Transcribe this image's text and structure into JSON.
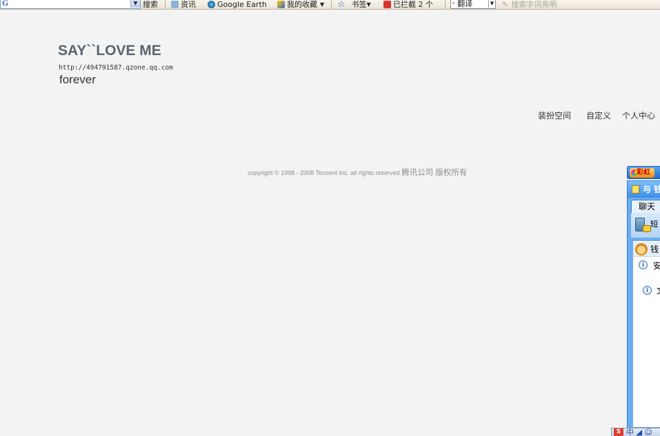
{
  "toolbar": {
    "google_logo": "G",
    "search_label": "搜索",
    "news_label": "资讯",
    "earth_label": "Google Earth",
    "bookmarks_label": "我的收藏",
    "star_label": "书签",
    "blocked_label": "已拦截 2 个",
    "translate_label": "翻译",
    "hint_text": "搜索字词亮明"
  },
  "site": {
    "title": "SAY``LOVE ME",
    "url": "http://494791587.qzone.qq.com",
    "subtitle": "forever"
  },
  "nav": {
    "decorate": "装扮空间",
    "customize": "自定义",
    "personal_center": "个人中心"
  },
  "footer": {
    "copyright_en": "copyright © 1998 - 2008 Tencent Inc. all rights reserved",
    "copyright_cn": "腾讯公司  版权所有"
  },
  "qq_panel": {
    "tab_label": "彩虹",
    "header": "与 钱",
    "chat_tab": "聊天",
    "sms_label": "短",
    "contact": "钱",
    "notice_1": "安",
    "notice_2": "文"
  },
  "ime": {
    "logo": "S",
    "mode": "中",
    "punct": "◢ ☺"
  },
  "colors": {
    "background": "#f3f3f3",
    "title": "#5a6470",
    "qq_blue": "#6aaef0"
  }
}
